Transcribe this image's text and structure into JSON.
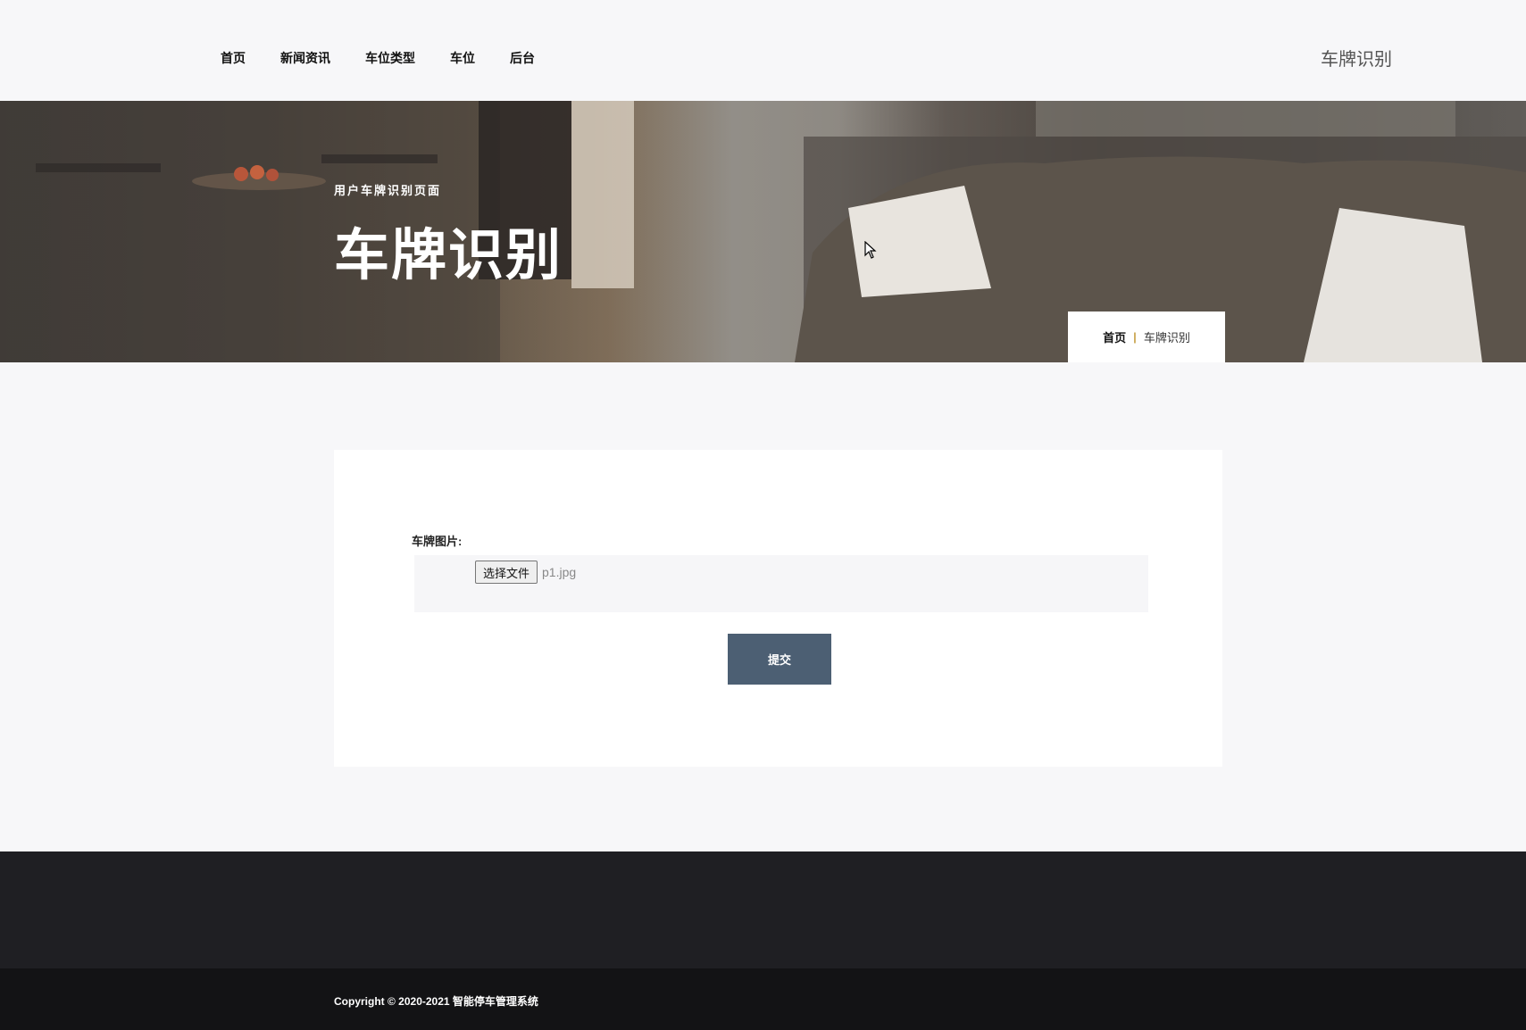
{
  "nav": {
    "items": [
      "首页",
      "新闻资讯",
      "车位类型",
      "车位",
      "后台"
    ],
    "brand": "车牌识别"
  },
  "hero": {
    "subtitle": "用户车牌识别页面",
    "title": "车牌识别",
    "breadcrumb": {
      "home": "首页",
      "separator": "|",
      "current": "车牌识别"
    }
  },
  "form": {
    "label": "车牌图片:",
    "file_button": "选择文件",
    "file_name": "p1.jpg",
    "submit": "提交"
  },
  "footer": {
    "copyright": "Copyright © 2020-2021 智能停车管理系统"
  },
  "colors": {
    "accent": "#4c5f73",
    "separator": "#c8a24a",
    "footer_top": "#1f1f23",
    "footer_bottom": "#131315"
  }
}
